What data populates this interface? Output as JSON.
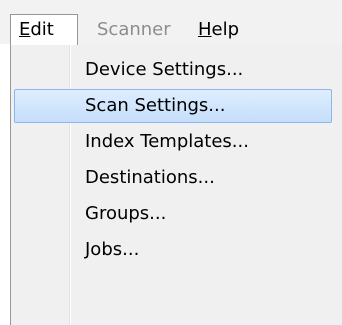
{
  "menubar": {
    "edit": {
      "mnemonic": "E",
      "rest": "dit"
    },
    "scanner": "Scanner",
    "help": {
      "mnemonic": "H",
      "rest": "elp"
    }
  },
  "edit_menu": {
    "items": [
      {
        "label": "Device Settings...",
        "highlighted": false
      },
      {
        "label": "Scan Settings...",
        "highlighted": true
      },
      {
        "label": "Index Templates...",
        "highlighted": false
      },
      {
        "label": "Destinations...",
        "highlighted": false
      },
      {
        "label": "Groups...",
        "highlighted": false
      },
      {
        "label": "Jobs...",
        "highlighted": false
      }
    ]
  },
  "colors": {
    "highlight_fill": "#cfe4fb",
    "highlight_border": "#8ab8ec",
    "disabled_text": "#8d8d8d",
    "menu_background": "#f0f0f0"
  }
}
